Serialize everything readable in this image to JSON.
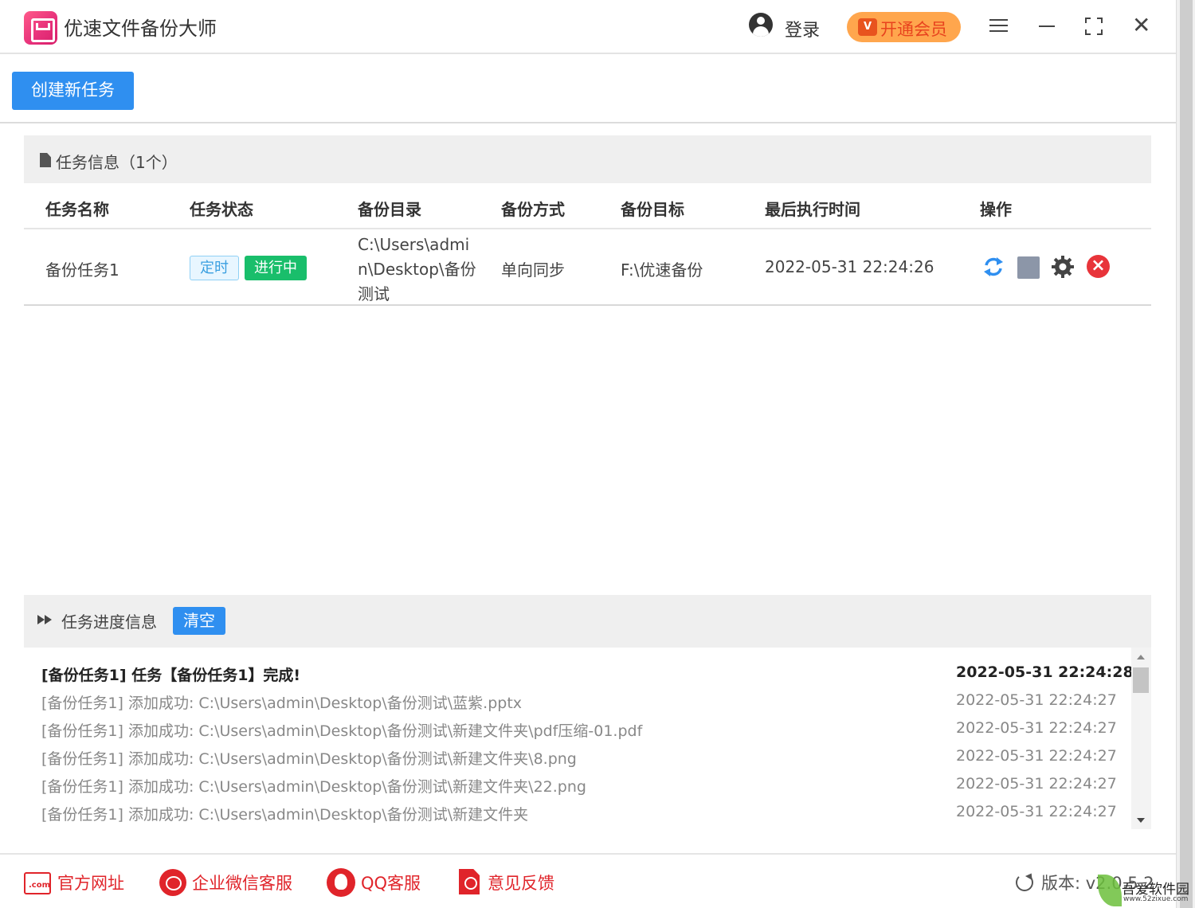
{
  "app": {
    "title": "优速文件备份大师",
    "login_label": "登录",
    "vip_badge": "V",
    "vip_label": "开通会员"
  },
  "toolbar": {
    "create_label": "创建新任务"
  },
  "task_panel": {
    "title": "任务信息（1个）",
    "columns": [
      "任务名称",
      "任务状态",
      "备份目录",
      "备份方式",
      "备份目标",
      "最后执行时间",
      "操作"
    ],
    "rows": [
      {
        "name": "备份任务1",
        "status_tags": [
          "定时",
          "进行中"
        ],
        "source_dir": "C:\\Users\\admin\\Desktop\\备份测试",
        "mode": "单向同步",
        "target": "F:\\优速备份",
        "last_run": "2022-05-31 22:24:26",
        "actions": [
          "sync-icon",
          "stop-icon",
          "gear-icon",
          "delete-icon"
        ]
      }
    ]
  },
  "progress_panel": {
    "title": "任务进度信息",
    "clear_label": "清空",
    "logs": [
      {
        "msg": "[备份任务1] 任务【备份任务1】完成!",
        "time": "2022-05-31 22:24:28"
      },
      {
        "msg": "[备份任务1] 添加成功:   C:\\Users\\admin\\Desktop\\备份测试\\蓝紫.pptx",
        "time": "2022-05-31 22:24:27"
      },
      {
        "msg": "[备份任务1] 添加成功:   C:\\Users\\admin\\Desktop\\备份测试\\新建文件夹\\pdf压缩-01.pdf",
        "time": "2022-05-31 22:24:27"
      },
      {
        "msg": "[备份任务1] 添加成功:   C:\\Users\\admin\\Desktop\\备份测试\\新建文件夹\\8.png",
        "time": "2022-05-31 22:24:27"
      },
      {
        "msg": "[备份任务1] 添加成功:   C:\\Users\\admin\\Desktop\\备份测试\\新建文件夹\\22.png",
        "time": "2022-05-31 22:24:27"
      },
      {
        "msg": "[备份任务1] 添加成功:   C:\\Users\\admin\\Desktop\\备份测试\\新建文件夹",
        "time": "2022-05-31 22:24:27"
      }
    ]
  },
  "footer": {
    "website_icon_text": ".com",
    "website_label": "官方网址",
    "wechat_label": "企业微信客服",
    "qq_label": "QQ客服",
    "feedback_label": "意见反馈",
    "version_label": "版本:  v2.0.5.2"
  },
  "watermark": {
    "text": "吾爱软件园",
    "url": "www.52zixue.com"
  },
  "colors": {
    "primary": "#2f8ff0",
    "success": "#19be6b",
    "danger": "#e8343a",
    "vip": "#ffa64d",
    "footer_accent": "#e0242a"
  }
}
